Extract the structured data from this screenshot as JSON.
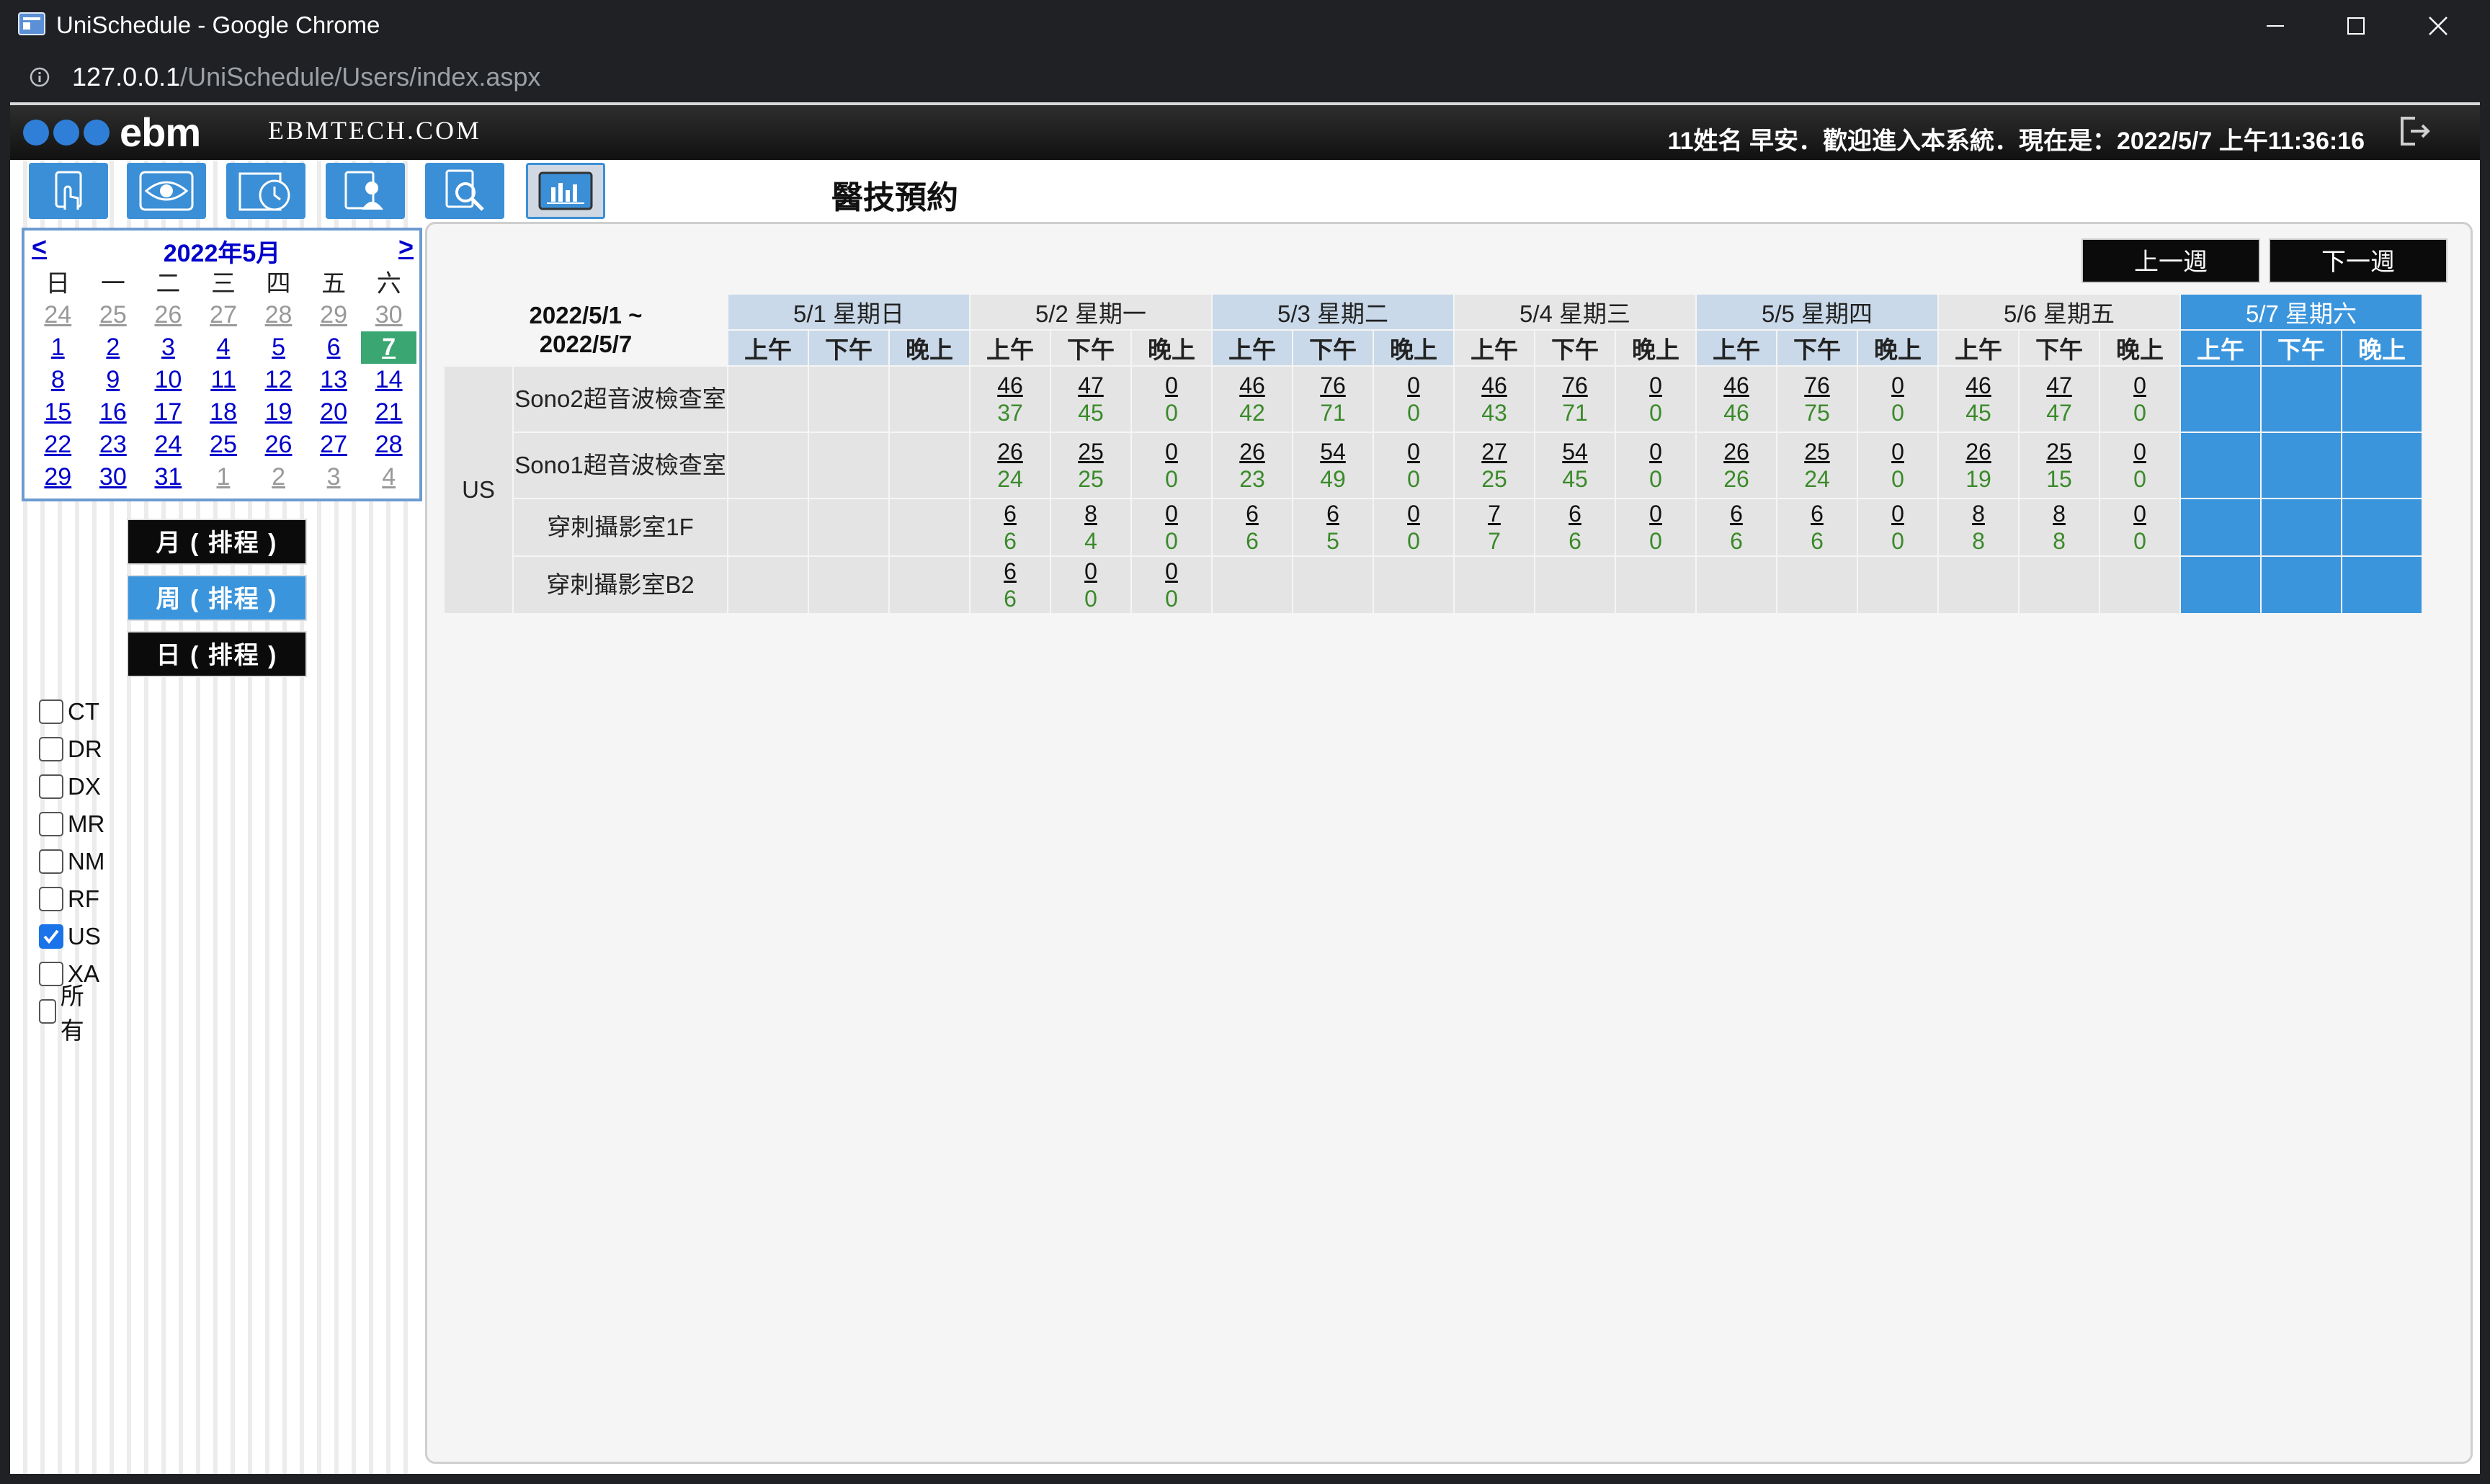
{
  "window": {
    "title": "UniSchedule - Google Chrome",
    "url_host": "127.0.0.1",
    "url_path": "/UniSchedule/Users/index.aspx"
  },
  "header": {
    "brand": "ebm",
    "site": "EBMTECH.COM",
    "welcome": "11姓名 早安．歡迎進入本系統．現在是：2022/5/7 上午11:36:16"
  },
  "page_title": "醫技預約",
  "calendar": {
    "prev": "<",
    "next": ">",
    "month": "2022年5月",
    "weekdays": [
      "日",
      "一",
      "二",
      "三",
      "四",
      "五",
      "六"
    ],
    "weeks": [
      [
        "24",
        "25",
        "26",
        "27",
        "28",
        "29",
        "30"
      ],
      [
        "1",
        "2",
        "3",
        "4",
        "5",
        "6",
        "7"
      ],
      [
        "8",
        "9",
        "10",
        "11",
        "12",
        "13",
        "14"
      ],
      [
        "15",
        "16",
        "17",
        "18",
        "19",
        "20",
        "21"
      ],
      [
        "22",
        "23",
        "24",
        "25",
        "26",
        "27",
        "28"
      ],
      [
        "29",
        "30",
        "31",
        "1",
        "2",
        "3",
        "4"
      ]
    ],
    "today": "7"
  },
  "schedule_buttons": {
    "month": "月 ( 排程 )",
    "week": "周 ( 排程 )",
    "day": "日 ( 排程 )"
  },
  "modalities": [
    {
      "label": "CT",
      "checked": false
    },
    {
      "label": "DR",
      "checked": false
    },
    {
      "label": "DX",
      "checked": false
    },
    {
      "label": "MR",
      "checked": false
    },
    {
      "label": "NM",
      "checked": false
    },
    {
      "label": "RF",
      "checked": false
    },
    {
      "label": "US",
      "checked": true
    },
    {
      "label": "XA",
      "checked": false
    },
    {
      "label": "所有",
      "checked": false
    }
  ],
  "week_nav": {
    "prev": "上一週",
    "next": "下一週"
  },
  "schedule": {
    "range_start": "2022/5/1 ~",
    "range_end": "2022/5/7",
    "days": [
      "5/1 星期日",
      "5/2 星期一",
      "5/3 星期二",
      "5/4 星期三",
      "5/5 星期四",
      "5/6 星期五",
      "5/7 星期六"
    ],
    "slots": [
      "上午",
      "下午",
      "晚上"
    ],
    "modality": "US",
    "rooms": [
      {
        "name": "Sono2超音波檢查室",
        "cells": [
          null,
          null,
          null,
          [
            "46",
            "37"
          ],
          [
            "47",
            "45"
          ],
          [
            "0",
            "0"
          ],
          [
            "46",
            "42"
          ],
          [
            "76",
            "71"
          ],
          [
            "0",
            "0"
          ],
          [
            "46",
            "43"
          ],
          [
            "76",
            "71"
          ],
          [
            "0",
            "0"
          ],
          [
            "46",
            "46"
          ],
          [
            "76",
            "75"
          ],
          [
            "0",
            "0"
          ],
          [
            "46",
            "45"
          ],
          [
            "47",
            "47"
          ],
          [
            "0",
            "0"
          ],
          null,
          null,
          null
        ]
      },
      {
        "name": "Sono1超音波檢查室",
        "cells": [
          null,
          null,
          null,
          [
            "26",
            "24"
          ],
          [
            "25",
            "25"
          ],
          [
            "0",
            "0"
          ],
          [
            "26",
            "23"
          ],
          [
            "54",
            "49"
          ],
          [
            "0",
            "0"
          ],
          [
            "27",
            "25"
          ],
          [
            "54",
            "45"
          ],
          [
            "0",
            "0"
          ],
          [
            "26",
            "26"
          ],
          [
            "25",
            "24"
          ],
          [
            "0",
            "0"
          ],
          [
            "26",
            "19"
          ],
          [
            "25",
            "15"
          ],
          [
            "0",
            "0"
          ],
          null,
          null,
          null
        ]
      },
      {
        "name": "穿刺攝影室1F",
        "cells": [
          null,
          null,
          null,
          [
            "6",
            "6"
          ],
          [
            "8",
            "4"
          ],
          [
            "0",
            "0"
          ],
          [
            "6",
            "6"
          ],
          [
            "6",
            "5"
          ],
          [
            "0",
            "0"
          ],
          [
            "7",
            "7"
          ],
          [
            "6",
            "6"
          ],
          [
            "0",
            "0"
          ],
          [
            "6",
            "6"
          ],
          [
            "6",
            "6"
          ],
          [
            "0",
            "0"
          ],
          [
            "8",
            "8"
          ],
          [
            "8",
            "8"
          ],
          [
            "0",
            "0"
          ],
          null,
          null,
          null
        ]
      },
      {
        "name": "穿刺攝影室B2",
        "cells": [
          null,
          null,
          null,
          [
            "6",
            "6"
          ],
          [
            "0",
            "0"
          ],
          [
            "0",
            "0"
          ],
          null,
          null,
          null,
          null,
          null,
          null,
          null,
          null,
          null,
          null,
          null,
          null,
          null,
          null,
          null
        ]
      }
    ]
  },
  "colors": {
    "accent_blue": "#3b95dc",
    "today_green": "#3aa672",
    "count_green": "#3a8a2a"
  }
}
